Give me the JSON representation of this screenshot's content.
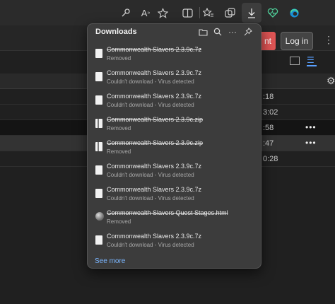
{
  "toolbar": {
    "icons": [
      "key-icon",
      "read-aloud-icon",
      "favorite-star-icon",
      "split-screen-icon",
      "favorites-icon",
      "collections-icon",
      "downloads-icon",
      "health-icon",
      "edge-icon"
    ],
    "read_aloud_glyph": "A",
    "read_aloud_sup": "»"
  },
  "background_page": {
    "red_button_label": "nt",
    "login_button_label": "Log in",
    "kebab": "⋮",
    "rows": [
      {
        "time": ":18",
        "dots": ""
      },
      {
        "time": "3:02",
        "dots": ""
      },
      {
        "time": ":58",
        "dots": "•••"
      },
      {
        "time": ":47",
        "dots": "•••"
      },
      {
        "time": "0:28",
        "dots": ""
      }
    ]
  },
  "downloads": {
    "title": "Downloads",
    "items": [
      {
        "name": "Commonwealth Slavers 2.3.9c.7z",
        "status": "Removed",
        "strike": true,
        "icon": "file-icon"
      },
      {
        "name": "Commonwealth Slavers 2.3.9c.7z",
        "status": "Couldn't download - Virus detected",
        "strike": false,
        "icon": "file-icon"
      },
      {
        "name": "Commonwealth Slavers 2.3.9c.7z",
        "status": "Couldn't download - Virus detected",
        "strike": false,
        "icon": "file-icon"
      },
      {
        "name": "Commonwealth Slavers 2.3.9c.zip",
        "status": "Removed",
        "strike": true,
        "icon": "zip-icon"
      },
      {
        "name": "Commonwealth Slavers 2.3.9c.zip",
        "status": "Removed",
        "strike": true,
        "icon": "zip-icon"
      },
      {
        "name": "Commonwealth Slavers 2.3.9c.7z",
        "status": "Couldn't download - Virus detected",
        "strike": false,
        "icon": "file-icon"
      },
      {
        "name": "Commonwealth Slavers 2.3.9c.7z",
        "status": "Couldn't download - Virus detected",
        "strike": false,
        "icon": "file-icon"
      },
      {
        "name": "Commonwealth Slavers Quest Stages.html",
        "status": "Removed",
        "strike": true,
        "icon": "edge-file-icon"
      },
      {
        "name": "Commonwealth Slavers 2.3.9c.7z",
        "status": "Couldn't download - Virus detected",
        "strike": false,
        "icon": "file-icon"
      }
    ],
    "see_more_label": "See more"
  }
}
